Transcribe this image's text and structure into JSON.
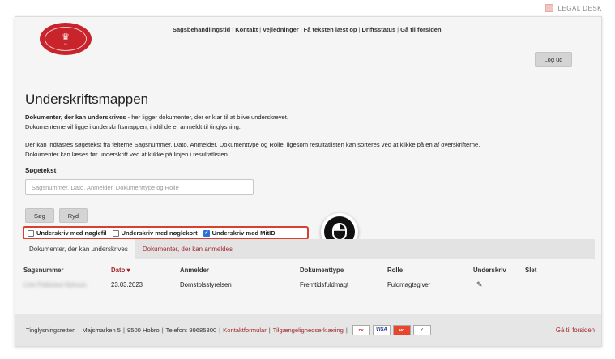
{
  "brand": {
    "label": "LEGAL DESK"
  },
  "logo": {
    "name": "court-seal-icon",
    "color": "#c9242b"
  },
  "topnav": {
    "items": [
      "Sagsbehandlingstid",
      "Kontakt",
      "Vejledninger",
      "Få teksten læst op",
      "Driftsstatus",
      "Gå til forsiden"
    ],
    "separator": "|"
  },
  "header": {
    "logout_label": "Log ud"
  },
  "page": {
    "title": "Underskriftsmappen",
    "intro_bold": "Dokumenter, der kan underskrives",
    "intro_rest": " - her ligger dokumenter, der er klar til at blive underskrevet.",
    "intro_line2": "Dokumenterne vil ligge i underskriftsmappen, indtil de er anmeldt til tinglysning.",
    "help_line1": "Der kan indtastes søgetekst fra felterne Sagsnummer, Dato, Anmelder, Dokumenttype og Rolle, ligesom resultatlisten kan sorteres ved at klikke på en af overskrifterne.",
    "help_line2": "Dokumenter kan læses før underskrift ved at klikke på linjen i resultatlisten."
  },
  "search": {
    "label": "Søgetekst",
    "value": "",
    "placeholder": "Sagsnummer, Dato, Anmelder, Dokumenttype og Rolle",
    "search_button": "Søg",
    "clear_button": "Ryd"
  },
  "filters": [
    {
      "label": "Underskriv med nøglefil",
      "checked": false
    },
    {
      "label": "Underskriv med nøglekort",
      "checked": false
    },
    {
      "label": "Underskriv med MitID",
      "checked": true
    }
  ],
  "tabs": [
    {
      "label": "Dokumenter, der kan underskrives",
      "active": true
    },
    {
      "label": "Dokumenter, der kan anmeldes",
      "active": false
    }
  ],
  "table": {
    "columns": [
      "Sagsnummer",
      "Dato",
      "Anmelder",
      "Dokumenttype",
      "Rolle",
      "Underskriv",
      "Slet"
    ],
    "sort_column": "Dato",
    "sort_direction": "descending",
    "rows": [
      {
        "sagsnummer": "Line Pakkstue Nyhuus",
        "dato": "23.03.2023",
        "anmelder": "Domstolsstyrelsen",
        "dokumenttype": "Fremtidsfuldmagt",
        "rolle": "Fuldmagtsgiver",
        "underskriv_icon": "pencil-icon",
        "slet": ""
      }
    ]
  },
  "footer": {
    "address_parts": [
      "Tinglysningsretten",
      "Majsmarken 5",
      "9500 Hobro",
      "Telefon: 99685800"
    ],
    "links": [
      "Kontaktformular",
      "Tilgængelighedserklæring"
    ],
    "payment_icons": [
      "dankort-icon",
      "visa-icon",
      "mastercard-icon",
      "secure-icon"
    ],
    "right_link": "Gå til forsiden"
  },
  "colors": {
    "accent_red": "#a1282c",
    "highlight_border": "#d94030",
    "checkbox_blue": "#2f6fd6"
  }
}
